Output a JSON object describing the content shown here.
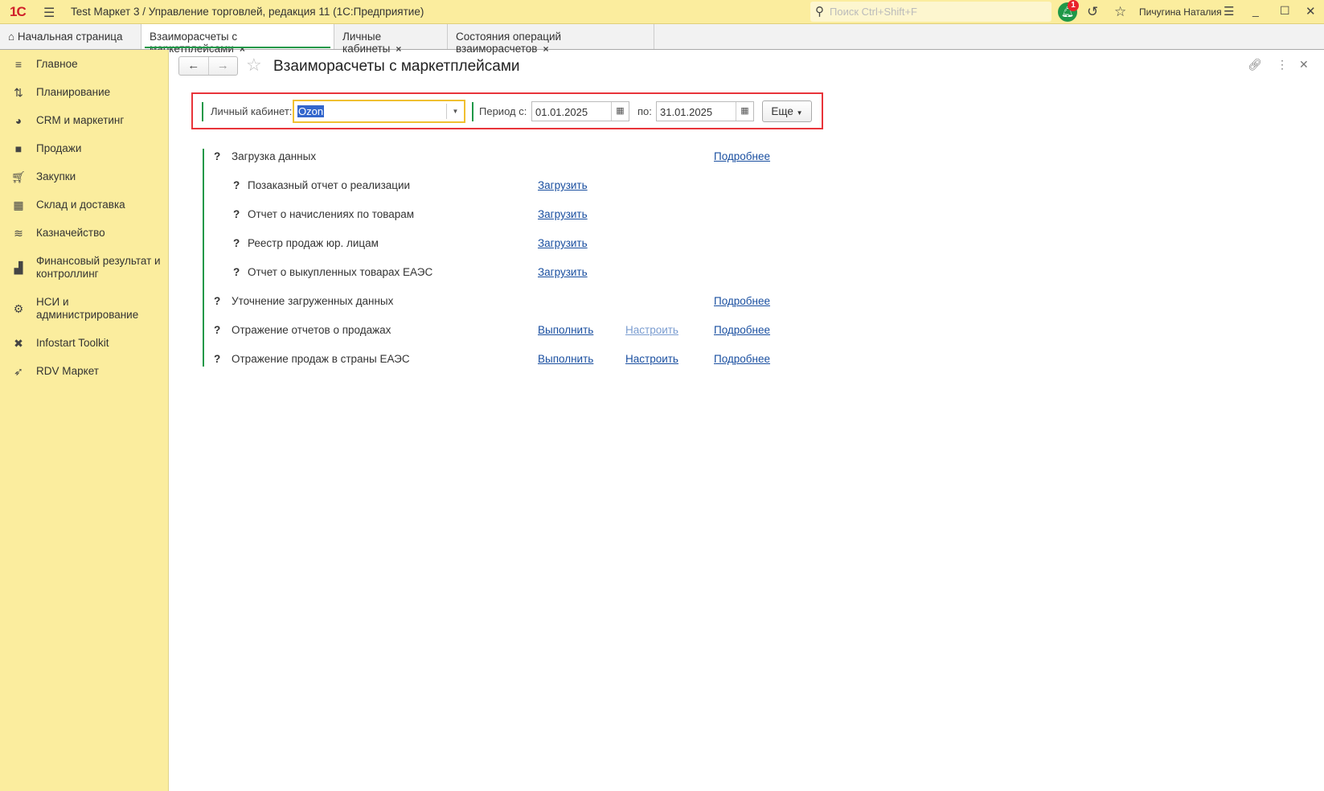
{
  "titlebar": {
    "logo": "1С",
    "title": "Test Маркет 3 / Управление торговлей, редакция 11  (1С:Предприятие)",
    "search_placeholder": "Поиск Ctrl+Shift+F",
    "notifications": "1",
    "user": "Пичугина Наталия"
  },
  "tabs": [
    {
      "label": "Начальная страница"
    },
    {
      "label": "Взаиморасчеты с маркетплейсами"
    },
    {
      "label": "Личные кабинеты"
    },
    {
      "label": "Состояния операций взаиморасчетов"
    }
  ],
  "sidebar": {
    "items": [
      {
        "label": "Главное",
        "icon": "menu-icon"
      },
      {
        "label": "Планирование",
        "icon": "planning-icon"
      },
      {
        "label": "CRM и маркетинг",
        "icon": "pie-icon"
      },
      {
        "label": "Продажи",
        "icon": "bag-icon"
      },
      {
        "label": "Закупки",
        "icon": "cart-icon"
      },
      {
        "label": "Склад и доставка",
        "icon": "warehouse-icon"
      },
      {
        "label": "Казначейство",
        "icon": "coins-icon"
      },
      {
        "label": "Финансовый результат и контроллинг",
        "icon": "bar-chart-icon"
      },
      {
        "label": "НСИ и администрирование",
        "icon": "gear-icon"
      },
      {
        "label": "Infostart Toolkit",
        "icon": "tools-icon"
      },
      {
        "label": "RDV Маркет",
        "icon": "rocket-icon"
      }
    ]
  },
  "page": {
    "title": "Взаиморасчеты с маркетплейсами"
  },
  "filters": {
    "cabinet_label": "Личный кабинет:",
    "cabinet_value": "Ozon",
    "period_from_label": "Период с:",
    "period_from": "01.01.2025",
    "period_to_label": "по:",
    "period_to": "31.01.2025",
    "more_label": "Еще"
  },
  "steps": [
    {
      "q": "?",
      "label": "Загрузка данных",
      "details": "Подробнее"
    },
    {
      "q": "?",
      "label": "Позаказный отчет о реализации",
      "load": "Загрузить"
    },
    {
      "q": "?",
      "label": "Отчет о начислениях по товарам",
      "load": "Загрузить"
    },
    {
      "q": "?",
      "label": "Реестр продаж юр. лицам",
      "load": "Загрузить"
    },
    {
      "q": "?",
      "label": "Отчет о выкупленных товарах ЕАЭС",
      "load": "Загрузить"
    },
    {
      "q": "?",
      "label": "Уточнение загруженных данных",
      "details": "Подробнее"
    },
    {
      "q": "?",
      "label": "Отражение отчетов о продажах",
      "run": "Выполнить",
      "setup": "Настроить",
      "details": "Подробнее"
    },
    {
      "q": "?",
      "label": "Отражение продаж в страны ЕАЭС",
      "run": "Выполнить",
      "setup": "Настроить",
      "details": "Подробнее"
    }
  ]
}
